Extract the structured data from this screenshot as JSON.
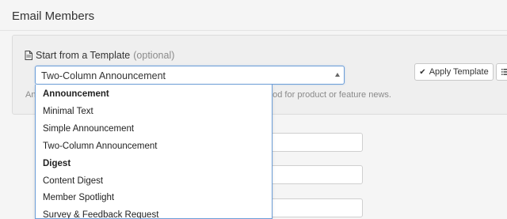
{
  "page": {
    "title": "Email Members"
  },
  "template_section": {
    "heading": "Start from a Template",
    "optional_label": "(optional)",
    "select_value": "Two-Column Announcement",
    "help_text_left": "An",
    "help_text_right": "Good for product or feature news."
  },
  "toolbar": {
    "apply_label": "Apply Template",
    "apply_icon": "check-icon",
    "list_icon": "list-icon"
  },
  "dropdown": {
    "items": [
      {
        "label": "Announcement",
        "group": true
      },
      {
        "label": "Minimal Text",
        "group": false
      },
      {
        "label": "Simple Announcement",
        "group": false
      },
      {
        "label": "Two-Column Announcement",
        "group": false
      },
      {
        "label": "Digest",
        "group": true
      },
      {
        "label": "Content Digest",
        "group": false
      },
      {
        "label": "Member Spotlight",
        "group": false
      },
      {
        "label": "Survey & Feedback Request",
        "group": false
      }
    ]
  },
  "colors": {
    "focus_border": "#6c9ed8",
    "panel_bg": "#efefef",
    "page_bg": "#f5f5f5"
  }
}
